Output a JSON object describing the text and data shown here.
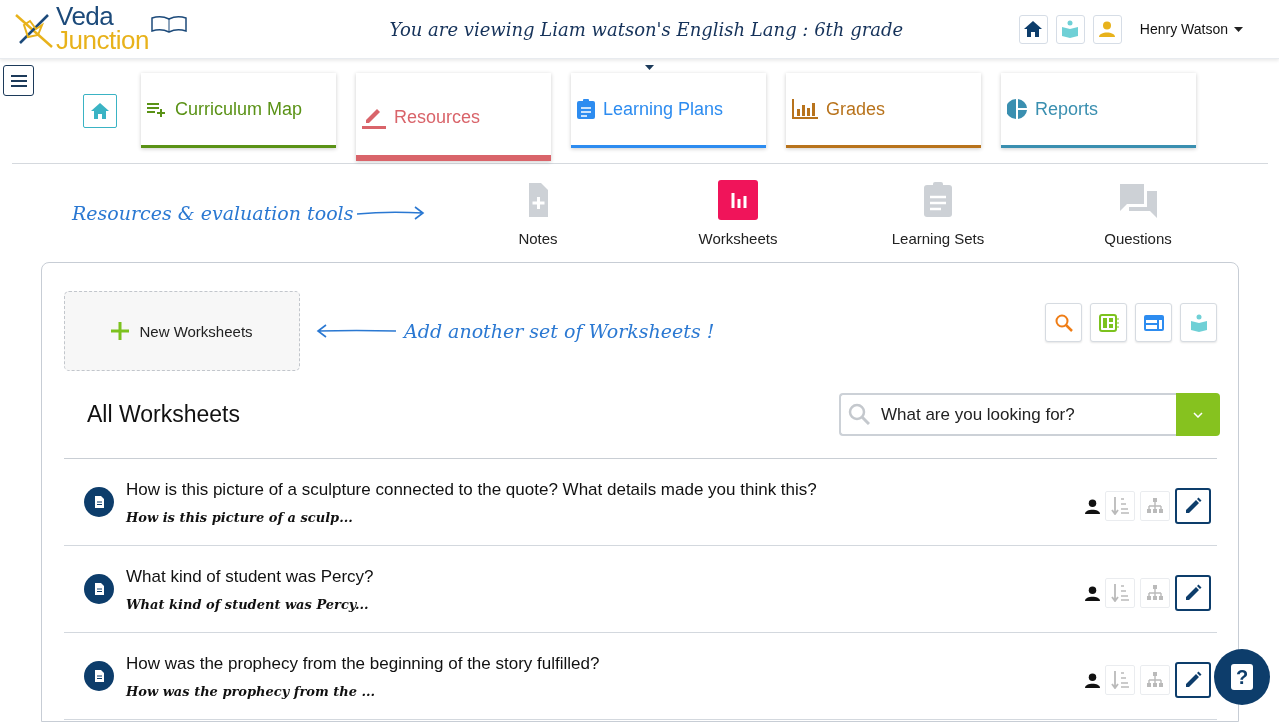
{
  "header": {
    "logo_top": "Veda",
    "logo_bottom": "Junction",
    "title": "You are viewing Liam watson's English Lang : 6th grade",
    "user_name": "Henry Watson"
  },
  "nav_tabs": [
    {
      "kind": "curriculum",
      "label": "Curriculum Map",
      "color": "#5a9216",
      "selected": false
    },
    {
      "kind": "resources",
      "label": "Resources",
      "color": "#d9646a",
      "selected": true
    },
    {
      "kind": "plans",
      "label": "Learning Plans",
      "color": "#2d8cf0",
      "selected": false
    },
    {
      "kind": "grades",
      "label": "Grades",
      "color": "#b8731c",
      "selected": false
    },
    {
      "kind": "reports",
      "label": "Reports",
      "color": "#3a8fb0",
      "selected": false
    }
  ],
  "tools_annotation": "Resources & evaluation tools",
  "resource_types": [
    {
      "kind": "notes",
      "label": "Notes",
      "selected": false
    },
    {
      "kind": "worksheets",
      "label": "Worksheets",
      "selected": true
    },
    {
      "kind": "sets",
      "label": "Learning Sets",
      "selected": false
    },
    {
      "kind": "questions",
      "label": "Questions",
      "selected": false
    }
  ],
  "new_button": "New Worksheets",
  "new_annotation": "Add another set of Worksheets !",
  "list_title": "All Worksheets",
  "search": {
    "placeholder": "What are you looking for?"
  },
  "worksheets": [
    {
      "title": "How is this picture of a sculpture connected to the quote? What details made you think this?",
      "subtitle": "How is this picture of a sculp...",
      "sort_disabled": true,
      "tree_disabled": true
    },
    {
      "title": "What kind of student was Percy?",
      "subtitle": "What kind of student was Percy...",
      "sort_disabled": true,
      "tree_disabled": true
    },
    {
      "title": "How was the prophecy from the beginning of the story fulfilled?",
      "subtitle": "How was the prophecy from the ...",
      "sort_disabled": true,
      "tree_disabled": true
    }
  ],
  "help_button": "?"
}
